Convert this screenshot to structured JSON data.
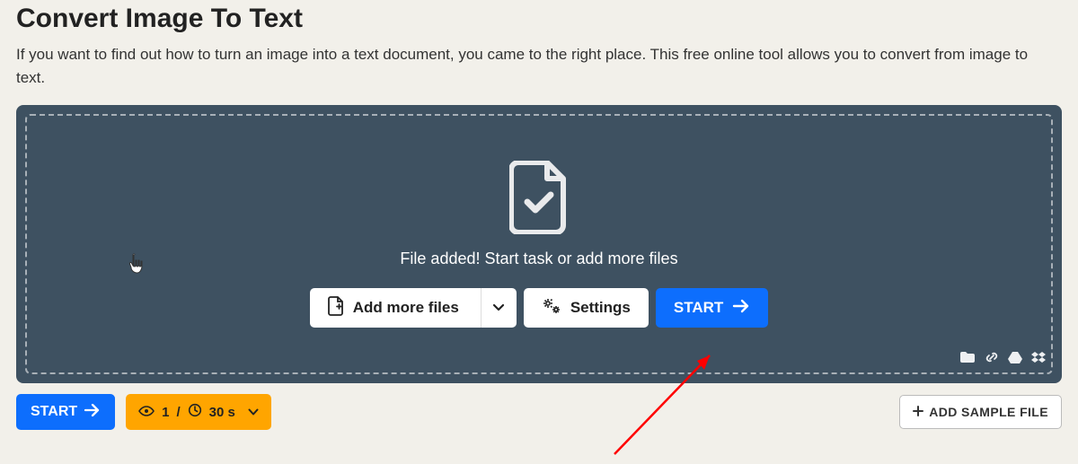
{
  "header": {
    "title": "Convert Image To Text",
    "description": "If you want to find out how to turn an image into a text document, you came to the right place. This free online tool allows you to convert from image to text."
  },
  "dropzone": {
    "status": "File added! Start task or add more files",
    "add_more_label": "Add more files",
    "settings_label": "Settings",
    "start_label": "START"
  },
  "bottom": {
    "start_label": "START",
    "queue_count": "1",
    "queue_sep": "/",
    "time_value": "30 s",
    "add_sample_label": "ADD SAMPLE FILE"
  }
}
